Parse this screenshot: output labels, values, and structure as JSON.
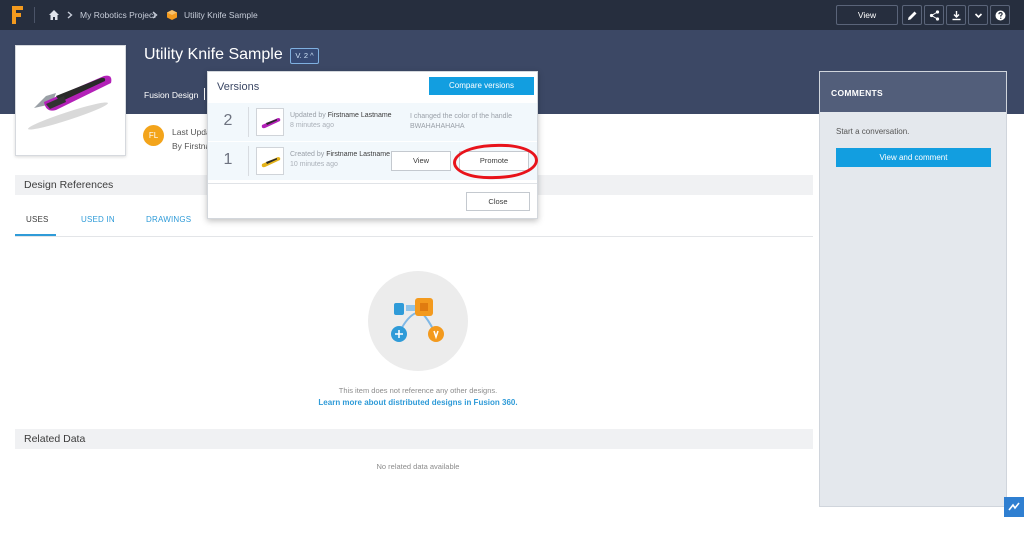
{
  "breadcrumb": {
    "project": "My Robotics Project",
    "item": "Utility Knife Sample"
  },
  "toolbar": {
    "view_label": "View",
    "icons": [
      "pencil-icon",
      "share-icon",
      "download-icon",
      "chevron-down-icon",
      "help-icon"
    ]
  },
  "header": {
    "title": "Utility Knife Sample",
    "version_chip": "V. 2",
    "type": "Fusion Design"
  },
  "meta": {
    "avatar_initials": "FL",
    "last_updated_partial": "Last Upda",
    "by_partial": "By Firstna"
  },
  "design_references": {
    "title": "Design References",
    "tabs": [
      "USES",
      "USED IN",
      "DRAWINGS"
    ],
    "active_tab": "USES",
    "empty_text": "This item does not reference any other designs.",
    "learn_link": "Learn more about distributed designs in Fusion 360."
  },
  "related_data": {
    "title": "Related Data",
    "empty_text": "No related data available"
  },
  "comments": {
    "title": "COMMENTS",
    "start_text": "Start a conversation.",
    "button": "View and comment"
  },
  "versions_popover": {
    "title": "Versions",
    "compare_button": "Compare versions",
    "close_button": "Close",
    "versions": [
      {
        "number": "2",
        "action": "Updated by",
        "author": "Firstname Lastname",
        "time": "8 minutes ago",
        "note": "I changed the color of the handle BWAHAHAHAHA"
      },
      {
        "number": "1",
        "action": "Created by",
        "author": "Firstname Lastname",
        "time": "10 minutes ago",
        "view_button": "View",
        "promote_button": "Promote"
      }
    ]
  },
  "colors": {
    "topbar": "#262e3e",
    "header_band": "#3c4865",
    "accent_blue": "#129ee0",
    "link_blue": "#2f9bd8",
    "annotation_red": "#e8131b",
    "knife_handle_v2": "#b321b8",
    "knife_handle_v1": "#e4b31a"
  }
}
